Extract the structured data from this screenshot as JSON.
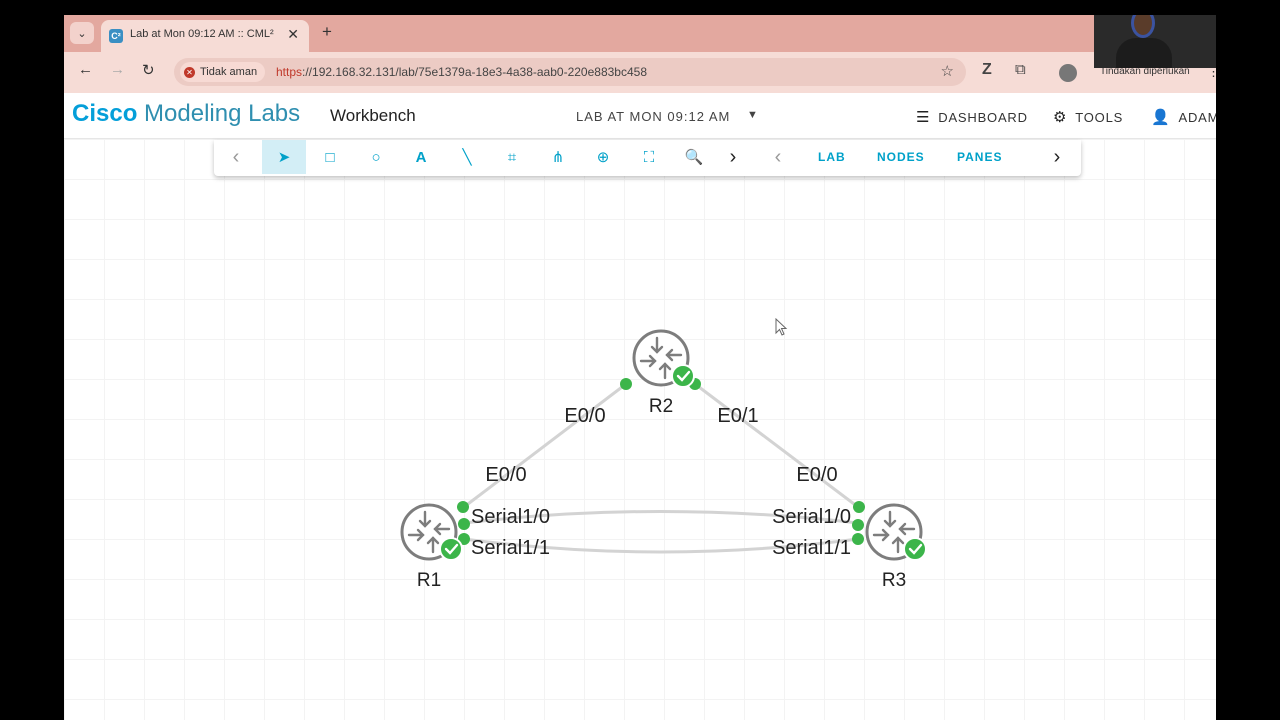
{
  "browser": {
    "tab_title": "Lab at Mon 09:12 AM :: CML²",
    "tab_favicon": "C²",
    "security_chip": "Tidak aman",
    "url_scheme": "https",
    "url_rest": "://192.168.32.131/lab/75e1379a-18e3-4a38-aab0-220e883bc458",
    "action_required": "Tindakan diperlukan"
  },
  "header": {
    "brand_bold": "Cisco",
    "brand_light": "Modeling Labs",
    "section": "Workbench",
    "lab_title": "LAB AT MON 09:12 AM",
    "dashboard": "DASHBOARD",
    "tools": "TOOLS",
    "user": "ADAM"
  },
  "palette": {
    "links": [
      "LAB",
      "NODES",
      "PANES"
    ]
  },
  "topology": {
    "nodes": [
      {
        "name": "R2",
        "status": "booted"
      },
      {
        "name": "R1",
        "status": "booted"
      },
      {
        "name": "R3",
        "status": "booted"
      }
    ],
    "links": [
      {
        "a": "R2",
        "a_if": "E0/0",
        "b": "R1",
        "b_if": "E0/0"
      },
      {
        "a": "R2",
        "a_if": "E0/1",
        "b": "R3",
        "b_if": "E0/0"
      },
      {
        "a": "R1",
        "a_if": "Serial1/0",
        "b": "R3",
        "b_if": "Serial1/0"
      },
      {
        "a": "R1",
        "a_if": "Serial1/1",
        "b": "R3",
        "b_if": "Serial1/1"
      }
    ]
  },
  "colors": {
    "accent": "#00a1c9",
    "status_ok": "#3cb54a",
    "link": "#d0d0d0"
  }
}
